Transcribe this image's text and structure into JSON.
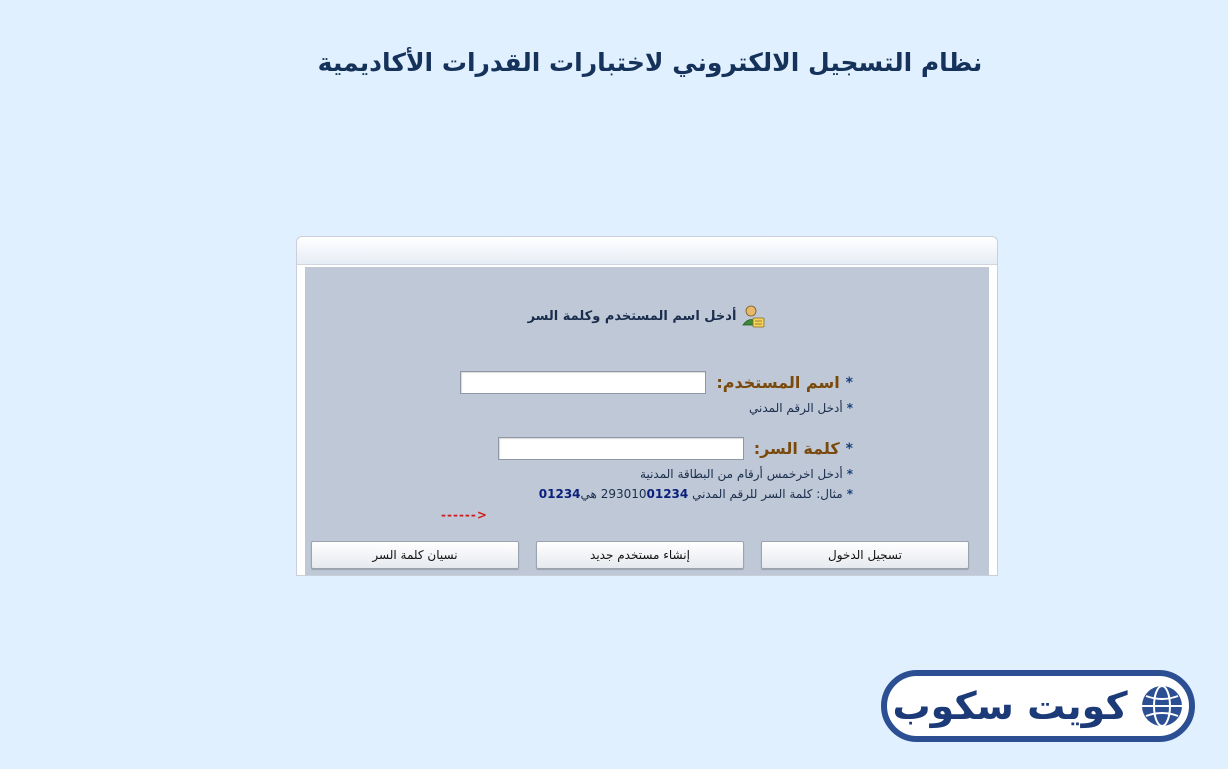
{
  "header": {
    "title": "نظام التسجيل الالكتروني لاختبارات القدرات الأكاديمية"
  },
  "login": {
    "prompt": "أدخل اسم المستخدم وكلمة السر",
    "username": {
      "label": "اسم المستخدم:",
      "value": "",
      "hint": "أدخل الرقم المدني"
    },
    "password": {
      "label": "كلمة السر:",
      "value": "",
      "hint": "أدخل اخرخمس أرقام من البطاقة المدنية",
      "example_prefix": "مثال: كلمة السر للرقم المدني",
      "example_civil_plain": "293010",
      "example_civil_bold": "01234",
      "example_middle": "هي",
      "example_password": "01234",
      "arrow": "------>"
    },
    "required_marker": "*",
    "buttons": {
      "login": "تسجيل الدخول",
      "new_user": "إنشاء مستخدم جديد",
      "forgot_password": "نسيان كلمة السر"
    }
  },
  "brand": {
    "name": "كويت سكوب"
  },
  "colors": {
    "page_background": "#e1f0fe",
    "panel_body": "#bfc8d6",
    "title": "#15325a",
    "label": "#7a4a0d",
    "brand": "#2c4f94",
    "arrow": "#d01a1a"
  },
  "icons": {
    "prompt": "user-icon",
    "brand": "globe-icon"
  }
}
